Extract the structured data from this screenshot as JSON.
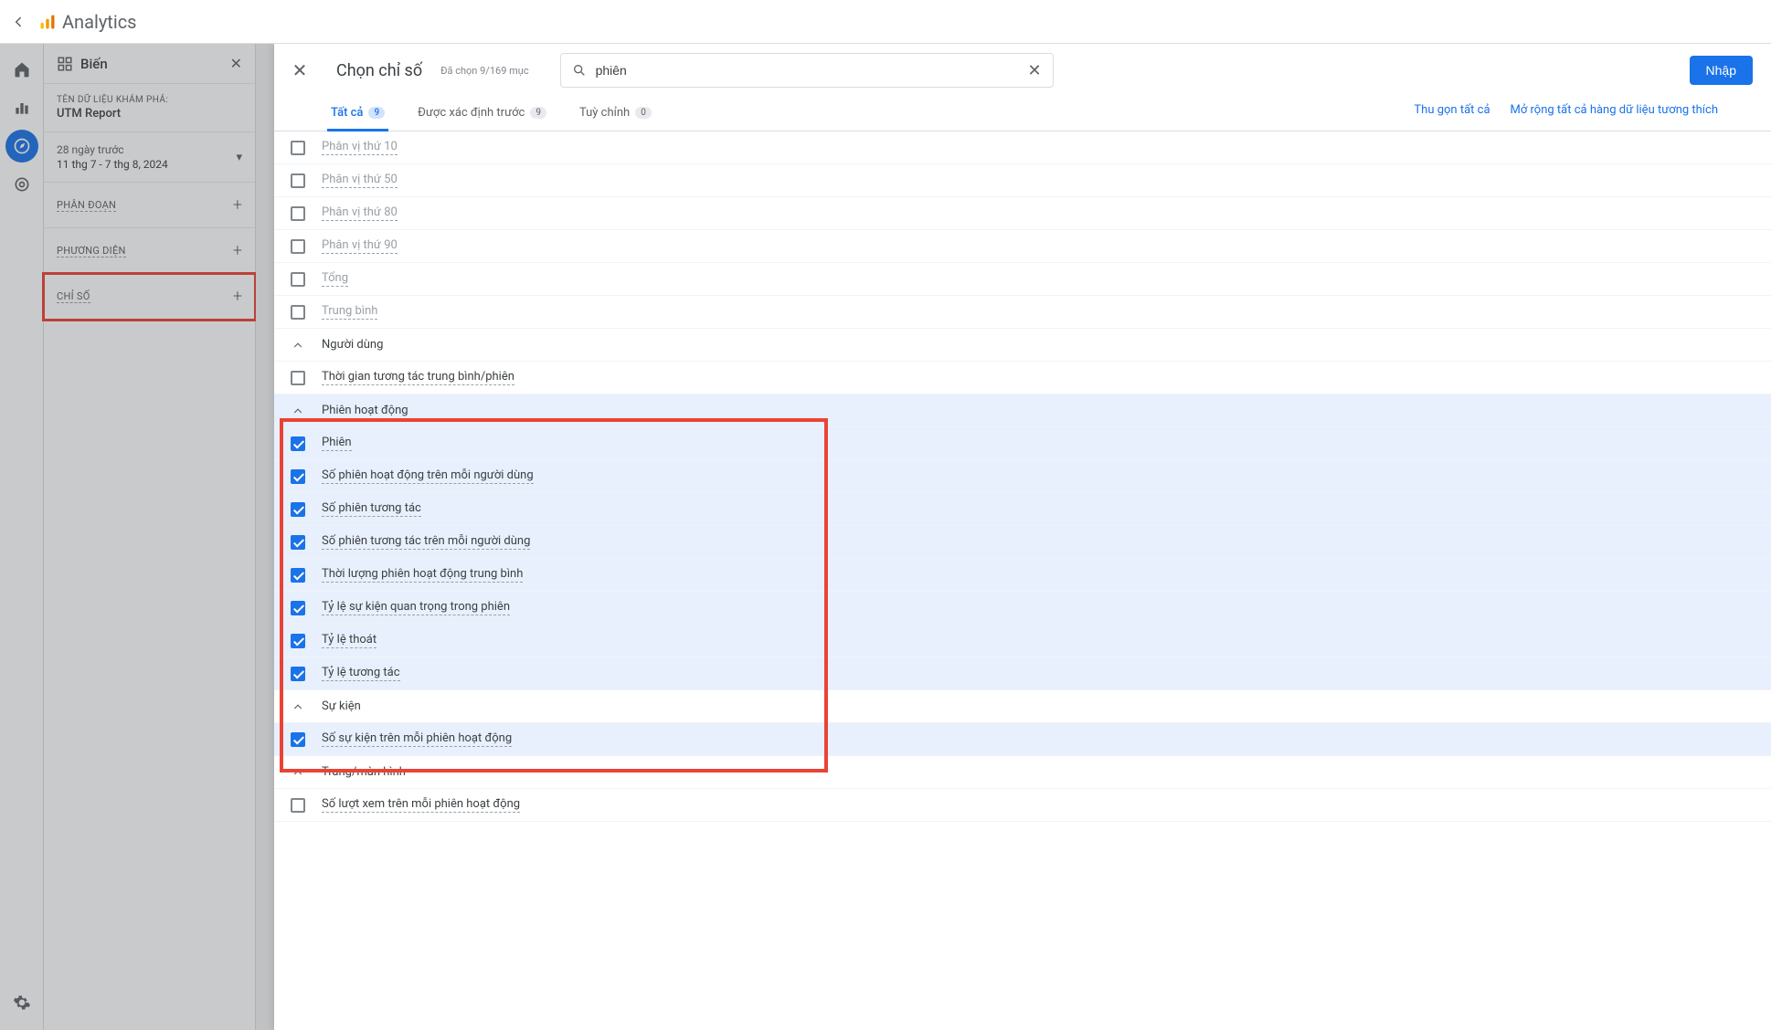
{
  "header": {
    "product": "Analytics"
  },
  "rail": {
    "items": [
      "home",
      "reports",
      "explore",
      "advertising"
    ],
    "active_index": 2
  },
  "var_panel": {
    "title": "Biến",
    "explore_name_label": "TÊN DỮ LIỆU KHÁM PHÁ:",
    "explore_name": "UTM Report",
    "date_preset": "28 ngày trước",
    "date_range": "11 thg 7 - 7 thg 8, 2024",
    "segments_label": "PHÂN ĐOẠN",
    "dimensions_label": "PHƯƠNG DIỆN",
    "metrics_label": "CHỈ SỐ"
  },
  "modal": {
    "title": "Chọn chỉ số",
    "subtitle": "Đã chọn 9/169 mục",
    "search_value": "phiên",
    "import_label": "Nhập",
    "tabs": [
      {
        "label": "Tất cả",
        "count": "9",
        "active": true
      },
      {
        "label": "Được xác định trước",
        "count": "9",
        "active": false
      },
      {
        "label": "Tuỳ chỉnh",
        "count": "0",
        "active": false
      }
    ],
    "collapse_all": "Thu gọn tất cả",
    "expand_compatible": "Mở rộng tất cả hàng dữ liệu tương thích",
    "rows": [
      {
        "type": "item",
        "label": "Phân vị thứ 10",
        "checked": false,
        "faded": true
      },
      {
        "type": "item",
        "label": "Phân vị thứ 50",
        "checked": false,
        "faded": true
      },
      {
        "type": "item",
        "label": "Phân vị thứ 80",
        "checked": false,
        "faded": true
      },
      {
        "type": "item",
        "label": "Phân vị thứ 90",
        "checked": false,
        "faded": true
      },
      {
        "type": "item",
        "label": "Tổng",
        "checked": false,
        "faded": true
      },
      {
        "type": "item",
        "label": "Trung bình",
        "checked": false,
        "faded": true
      },
      {
        "type": "group",
        "label": "Người dùng",
        "expanded": true
      },
      {
        "type": "item",
        "label": "Thời gian tương tác trung bình/phiên",
        "checked": false,
        "faded": false
      },
      {
        "type": "group",
        "label": "Phiên hoạt động",
        "expanded": true,
        "selected": true
      },
      {
        "type": "item",
        "label": "Phiên",
        "checked": true,
        "selected": true
      },
      {
        "type": "item",
        "label": "Số phiên hoạt động trên mỗi người dùng",
        "checked": true,
        "selected": true
      },
      {
        "type": "item",
        "label": "Số phiên tương tác",
        "checked": true,
        "selected": true
      },
      {
        "type": "item",
        "label": "Số phiên tương tác trên mỗi người dùng",
        "checked": true,
        "selected": true
      },
      {
        "type": "item",
        "label": "Thời lượng phiên hoạt động trung bình",
        "checked": true,
        "selected": true
      },
      {
        "type": "item",
        "label": "Tỷ lệ sự kiện quan trọng trong phiên",
        "checked": true,
        "selected": true
      },
      {
        "type": "item",
        "label": "Tỷ lệ thoát",
        "checked": true,
        "selected": true
      },
      {
        "type": "item",
        "label": "Tỷ lệ tương tác",
        "checked": true,
        "selected": true
      },
      {
        "type": "group",
        "label": "Sự kiện",
        "expanded": true
      },
      {
        "type": "item",
        "label": "Số sự kiện trên mỗi phiên hoạt động",
        "checked": true,
        "selected": true
      },
      {
        "type": "group",
        "label": "Trang/màn hình",
        "expanded": true
      },
      {
        "type": "item",
        "label": "Số lượt xem trên mỗi phiên hoạt động",
        "checked": false,
        "faded": false
      }
    ]
  }
}
